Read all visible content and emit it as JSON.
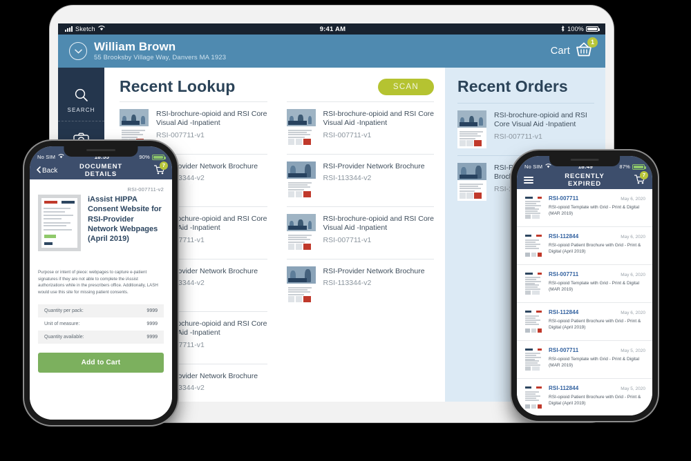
{
  "tablet": {
    "status_bar": {
      "carrier": "Sketch",
      "wifi_icon": "wifi-icon",
      "time": "9:41 AM",
      "bluetooth_icon": "bluetooth-icon",
      "battery": "100%"
    },
    "header": {
      "user_name": "William Brown",
      "user_address": "55 Brooksby Village Way, Danvers MA 1923",
      "chevron_icon": "chevron-down-icon",
      "cart_label": "Cart",
      "cart_icon": "basket-icon",
      "cart_badge": "1"
    },
    "sidebar": {
      "items": [
        {
          "label": "SEARCH",
          "icon": "search-icon"
        },
        {
          "label": "SCAN",
          "icon": "camera-icon"
        }
      ]
    },
    "recent_lookup": {
      "title": "Recent Lookup",
      "scan_button": "SCAN",
      "columns": [
        [
          {
            "title": "RSI-brochure-opioid and RSI Core Visual Aid -Inpatient",
            "code": "RSI-007711-v1",
            "thumb": "inpatient"
          },
          {
            "title": "RSI-Provider Network Brochure",
            "code": "RSI-113344-v2",
            "thumb": "provider"
          },
          {
            "title": "RSI-brochure-opioid and RSI Core Visual Aid -Inpatient",
            "code": "RSI-007711-v1",
            "thumb": "inpatient"
          },
          {
            "title": "RSI-Provider Network Brochure",
            "code": "RSI-113344-v2",
            "thumb": "provider"
          },
          {
            "title": "RSI-brochure-opioid and RSI Core Visual Aid -Inpatient",
            "code": "RSI-007711-v1",
            "thumb": "inpatient"
          },
          {
            "title": "RSI-Provider Network Brochure",
            "code": "RSI-113344-v2",
            "thumb": "provider"
          }
        ],
        [
          {
            "title": "RSI-brochure-opioid and RSI Core Visual Aid -Inpatient",
            "code": "RSI-007711-v1",
            "thumb": "inpatient"
          },
          {
            "title": "RSI-Provider Network Brochure",
            "code": "RSI-113344-v2",
            "thumb": "provider"
          },
          {
            "title": "RSI-brochure-opioid and RSI Core Visual Aid -Inpatient",
            "code": "RSI-007711-v1",
            "thumb": "inpatient"
          },
          {
            "title": "RSI-Provider Network Brochure",
            "code": "RSI-113344-v2",
            "thumb": "provider"
          }
        ]
      ]
    },
    "recent_orders": {
      "title": "Recent Orders",
      "items": [
        {
          "title": "RSI-brochure-opioid and RSI Core Visual Aid -Inpatient",
          "code": "RSI-007711-v1",
          "thumb": "inpatient"
        },
        {
          "title": "RSI-Provider Network Brochure",
          "code": "RSI-113344-v2",
          "thumb": "provider"
        }
      ]
    }
  },
  "phone_left": {
    "status_bar": {
      "carrier": "No SIM",
      "wifi_icon": "wifi-icon",
      "time": "18:55",
      "battery": "90%"
    },
    "navbar": {
      "back_label": "Back",
      "back_icon": "chevron-left-icon",
      "title": "DOCUMENT DETAILS",
      "cart_icon": "cart-icon",
      "cart_badge": "7"
    },
    "document": {
      "code": "RSI-007711-v2",
      "title": "iAssist HIPPA Consent Website for RSI-Provider Network Webpages (April 2019)",
      "description": "Purpose or intent of piece: webpages to capture e-patient signatures if they are not able to complete the iAssist authorizations while in the prescribers office. Additionally, LASH would use this site for missing patient consents.",
      "specs": [
        {
          "label": "Quantity per pack:",
          "value": "9999"
        },
        {
          "label": "Unit of measure:",
          "value": "9999"
        },
        {
          "label": "Quantity available:",
          "value": "9999"
        }
      ],
      "add_to_cart": "Add to Cart"
    }
  },
  "phone_right": {
    "status_bar": {
      "carrier": "No SIM",
      "wifi_icon": "wifi-icon",
      "time": "18:49",
      "battery": "87%"
    },
    "navbar": {
      "menu_icon": "hamburger-menu-icon",
      "title": "RECENTLY EXPIRED",
      "cart_icon": "cart-icon",
      "cart_badge": "7"
    },
    "items": [
      {
        "code": "RSI-007711",
        "date": "May 6, 2020",
        "desc": "RSI-opioid Template\nwith Grid - Print & Digital (MAR 2019)",
        "thumb": "template"
      },
      {
        "code": "RSI-112844",
        "date": "May 6, 2020",
        "desc": "RSI-opioid Patient Brochure\nwith Grid - Print & Digital (April 2019)",
        "thumb": "brochure"
      },
      {
        "code": "RSI-007711",
        "date": "May 6, 2020",
        "desc": "RSI-opioid Template\nwith Grid - Print & Digital (MAR 2019)",
        "thumb": "template"
      },
      {
        "code": "RSI-112844",
        "date": "May 6, 2020",
        "desc": "RSI-opioid Patient Brochure\nwith Grid - Print & Digital (April 2019)",
        "thumb": "brochure"
      },
      {
        "code": "RSI-007711",
        "date": "May 5, 2020",
        "desc": "RSI-opioid Template\nwith Grid - Print & Digital (MAR 2019)",
        "thumb": "template"
      },
      {
        "code": "RSI-112844",
        "date": "May 5, 2020",
        "desc": "RSI-opioid Patient Brochure\nwith Grid - Print & Digital (April 2019)",
        "thumb": "brochure"
      }
    ]
  },
  "colors": {
    "tablet_header_blue": "#4f8ab0",
    "sidebar_navy": "#24364d",
    "orders_panel": "#dceaf5",
    "scan_olive": "#b5c331",
    "add_cart_green": "#7cb05e",
    "phone_navy": "#3d4e6c",
    "badge_olive": "#b8c63a",
    "code_blue": "#2f5f9e"
  }
}
